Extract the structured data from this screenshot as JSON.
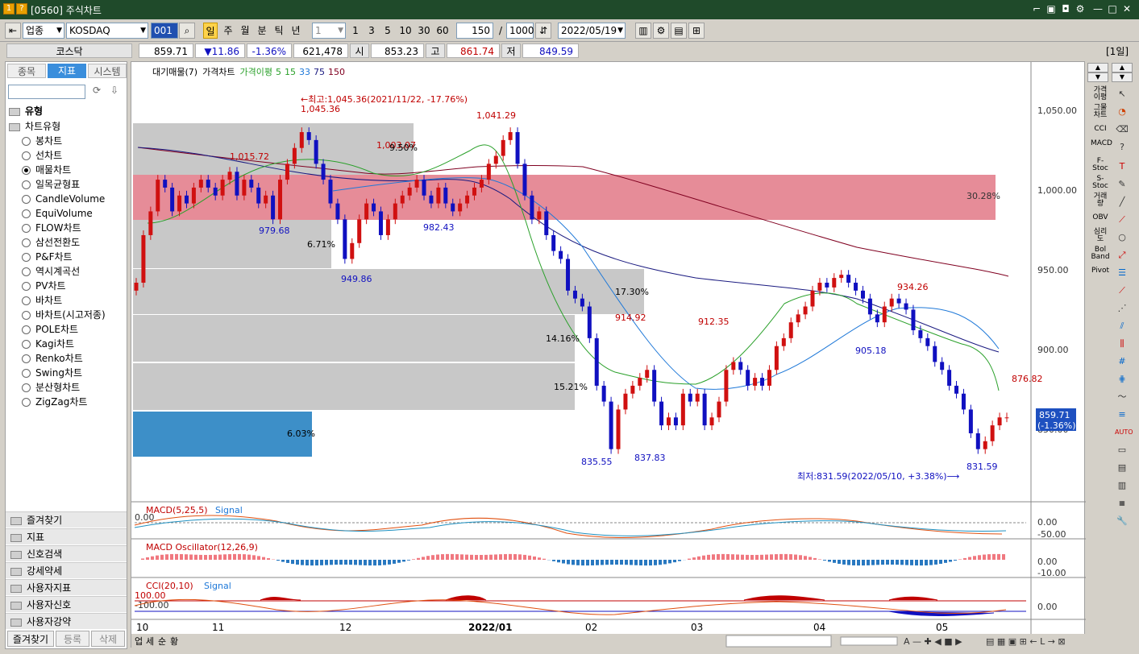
{
  "window": {
    "title": "[0560] 주식차트",
    "icon_num": "1",
    "icon_help": "?"
  },
  "toolbar": {
    "market_type": "업종",
    "market": "KOSDAQ",
    "code": "001",
    "period_buttons": [
      "일",
      "주",
      "월",
      "분",
      "틱",
      "년"
    ],
    "interval": "1",
    "interval_buttons": [
      "1",
      "3",
      "5",
      "10",
      "30",
      "60"
    ],
    "count": "150",
    "total": "1000",
    "slash": "/",
    "date": "2022/05/19"
  },
  "pricebar": {
    "name": "코스닥",
    "price": "859.71",
    "change": "▼11.86",
    "rate": "-1.36%",
    "volume": "621,478",
    "open_label": "시",
    "open": "853.23",
    "high_label": "고",
    "high": "861.74",
    "low_label": "저",
    "low": "849.59",
    "period_tag": "[1일]"
  },
  "leftpanel": {
    "tabs": [
      "종목",
      "지표",
      "시스템"
    ],
    "type_header": "유형",
    "tree_root": "차트유형",
    "chart_types": [
      "봉차트",
      "선차트",
      "매물차트",
      "일목균형표",
      "CandleVolume",
      "EquiVolume",
      "FLOW차트",
      "삼선전환도",
      "P&F차트",
      "역시계곡선",
      "PV차트",
      "바차트",
      "바차트(시고저종)",
      "POLE차트",
      "Kagi차트",
      "Renko차트",
      "Swing차트",
      "분산형차트",
      "ZigZag차트"
    ],
    "sections": [
      "즐겨찾기",
      "지표",
      "신호검색",
      "강세약세",
      "사용자지표",
      "사용자신호",
      "사용자강약"
    ],
    "bottom_buttons": [
      "즐겨찾기",
      "등록",
      "삭제"
    ]
  },
  "chart": {
    "legend": [
      "대기매물(7)",
      "가격차트",
      "가격이평",
      "5",
      "15",
      "33",
      "75",
      "150"
    ],
    "annotations": {
      "high_note": "←최고:1,045.36(2021/11/22, -17.76%)",
      "low_note": "최저:831.59(2022/05/10, +3.38%)⟶",
      "p1": "1,045.36",
      "p2": "1,015.72",
      "p3": "1,003.07",
      "p4": "979.68",
      "p5": "949.86",
      "p6": "982.43",
      "p7": "1,041.29",
      "p8": "914.92",
      "p9": "835.55",
      "p10": "837.83",
      "p11": "912.35",
      "p12": "905.18",
      "p13": "934.26",
      "p14": "876.82",
      "p15": "831.59",
      "pct1": "30.28%",
      "pct2": "6.71%",
      "pct3": "9.50%",
      "pct4": "17.30%",
      "pct5": "14.16%",
      "pct6": "15.21%",
      "pct7": "6.03%",
      "cur_price": "859.71",
      "cur_rate": "(-1.36%)"
    },
    "yticks": [
      "1,050.00",
      "1,000.00",
      "950.00",
      "900.00",
      "850.00"
    ],
    "xticks": [
      "10",
      "11",
      "12",
      "2022/01",
      "02",
      "03",
      "04",
      "05"
    ],
    "macd": {
      "title": "MACD(5,25,5)",
      "signal": "Signal",
      "zero": "0.00",
      "ticks": [
        "0.00",
        "-50.00"
      ]
    },
    "osc": {
      "title": "MACD Oscillator(12,26,9)",
      "ticks": [
        "0.00",
        "-10.00"
      ]
    },
    "cci": {
      "title": "CCI(20,10)",
      "signal": "Signal",
      "lvl1": "100.00",
      "lvl2": "-100.00",
      "ticks": [
        "0.00"
      ]
    },
    "bottom_tabs": [
      "업",
      "세",
      "순",
      "황"
    ]
  },
  "rightbar": {
    "labels": [
      "가격이평",
      "그물차트",
      "CCI",
      "MACD",
      "F-Stoc",
      "S-Stoc",
      "거래량",
      "OBV",
      "심리도",
      "Bol Band",
      "Pivot"
    ]
  },
  "chart_data": {
    "type": "candlestick",
    "title": "",
    "ylim": [
      820,
      1070
    ],
    "x_months": [
      "10",
      "11",
      "12",
      "2022/01",
      "02",
      "03",
      "04",
      "05"
    ],
    "closes": [
      945,
      975,
      990,
      1010,
      1005,
      990,
      1000,
      995,
      1005,
      1010,
      1005,
      1000,
      1010,
      1015,
      1000,
      1010,
      1005,
      995,
      1000,
      985,
      1010,
      1020,
      1030,
      1040,
      1035,
      1020,
      1010,
      995,
      985,
      960,
      970,
      985,
      995,
      990,
      975,
      985,
      995,
      1000,
      1005,
      1010,
      1000,
      995,
      1005,
      995,
      990,
      995,
      1000,
      1005,
      1010,
      1020,
      1025,
      1035,
      1040,
      1020,
      1000,
      985,
      990,
      975,
      965,
      960,
      940,
      935,
      930,
      910,
      880,
      870,
      840,
      865,
      875,
      880,
      885,
      890,
      870,
      855,
      860,
      855,
      875,
      870,
      875,
      855,
      860,
      870,
      890,
      895,
      890,
      880,
      885,
      880,
      890,
      905,
      910,
      920,
      925,
      930,
      940,
      945,
      942,
      948,
      950,
      945,
      940,
      935,
      925,
      920,
      930,
      935,
      932,
      928,
      915,
      910,
      905,
      895,
      890,
      880,
      875,
      865,
      850,
      840,
      845,
      855,
      860,
      860
    ]
  }
}
